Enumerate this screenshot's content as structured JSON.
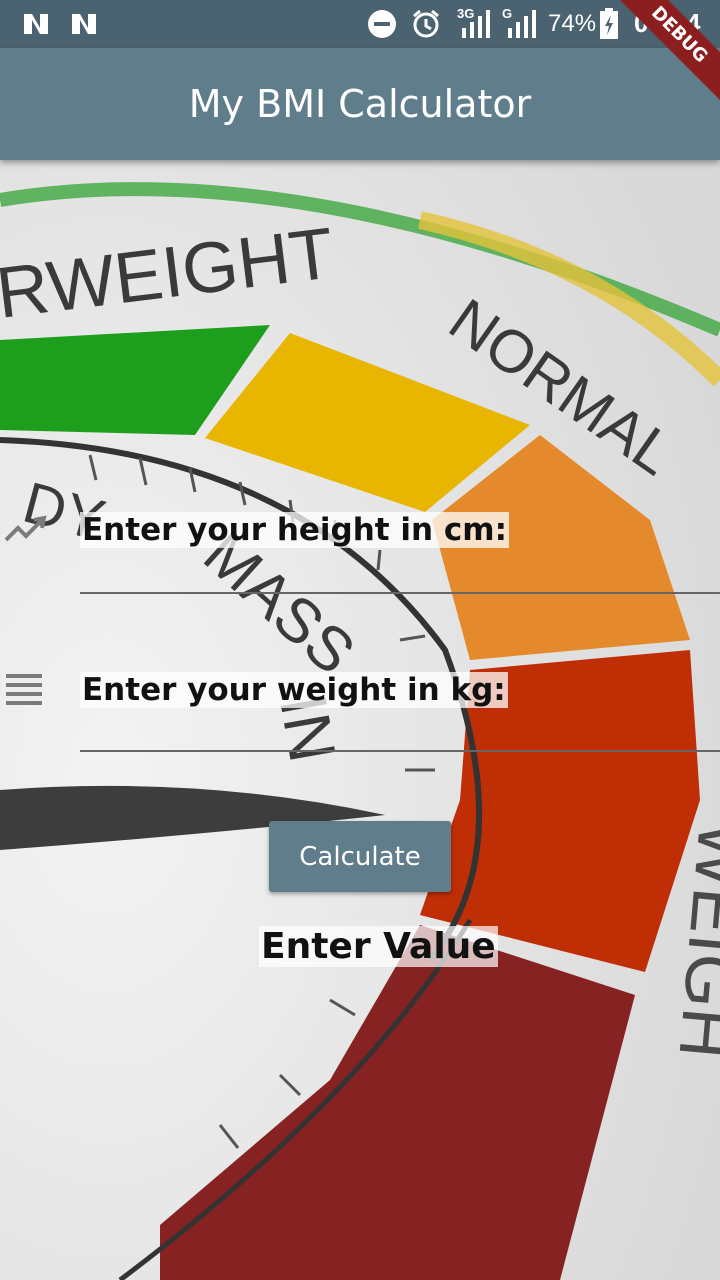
{
  "status_bar": {
    "network": "3G",
    "network2": "G",
    "battery": "74%",
    "time": "06:04",
    "icons": [
      "n-notification-icon",
      "n-notification-icon",
      "do-not-disturb-icon",
      "alarm-icon",
      "signal-icon",
      "signal-icon",
      "battery-charging-icon"
    ]
  },
  "app_bar": {
    "title": "My BMI Calculator"
  },
  "debug_banner": "DEBUG",
  "background": {
    "gauge_labels": {
      "underweight": "RWEIGHT",
      "normal": "NORMAL",
      "mass": "MASS",
      "index_letters": "IN",
      "overweight": "WEIGH",
      "body": "DY"
    }
  },
  "form": {
    "height": {
      "label": "Enter your height in cm:",
      "value": "",
      "icon": "trending-up-icon"
    },
    "weight": {
      "label": "Enter your weight in kg:",
      "value": "",
      "icon": "lines-icon"
    },
    "calculate_label": "Calculate",
    "result_text": "Enter Value"
  },
  "colors": {
    "appbar": "#607d8b",
    "statusbar": "#4b6270",
    "button": "#607d8b"
  }
}
